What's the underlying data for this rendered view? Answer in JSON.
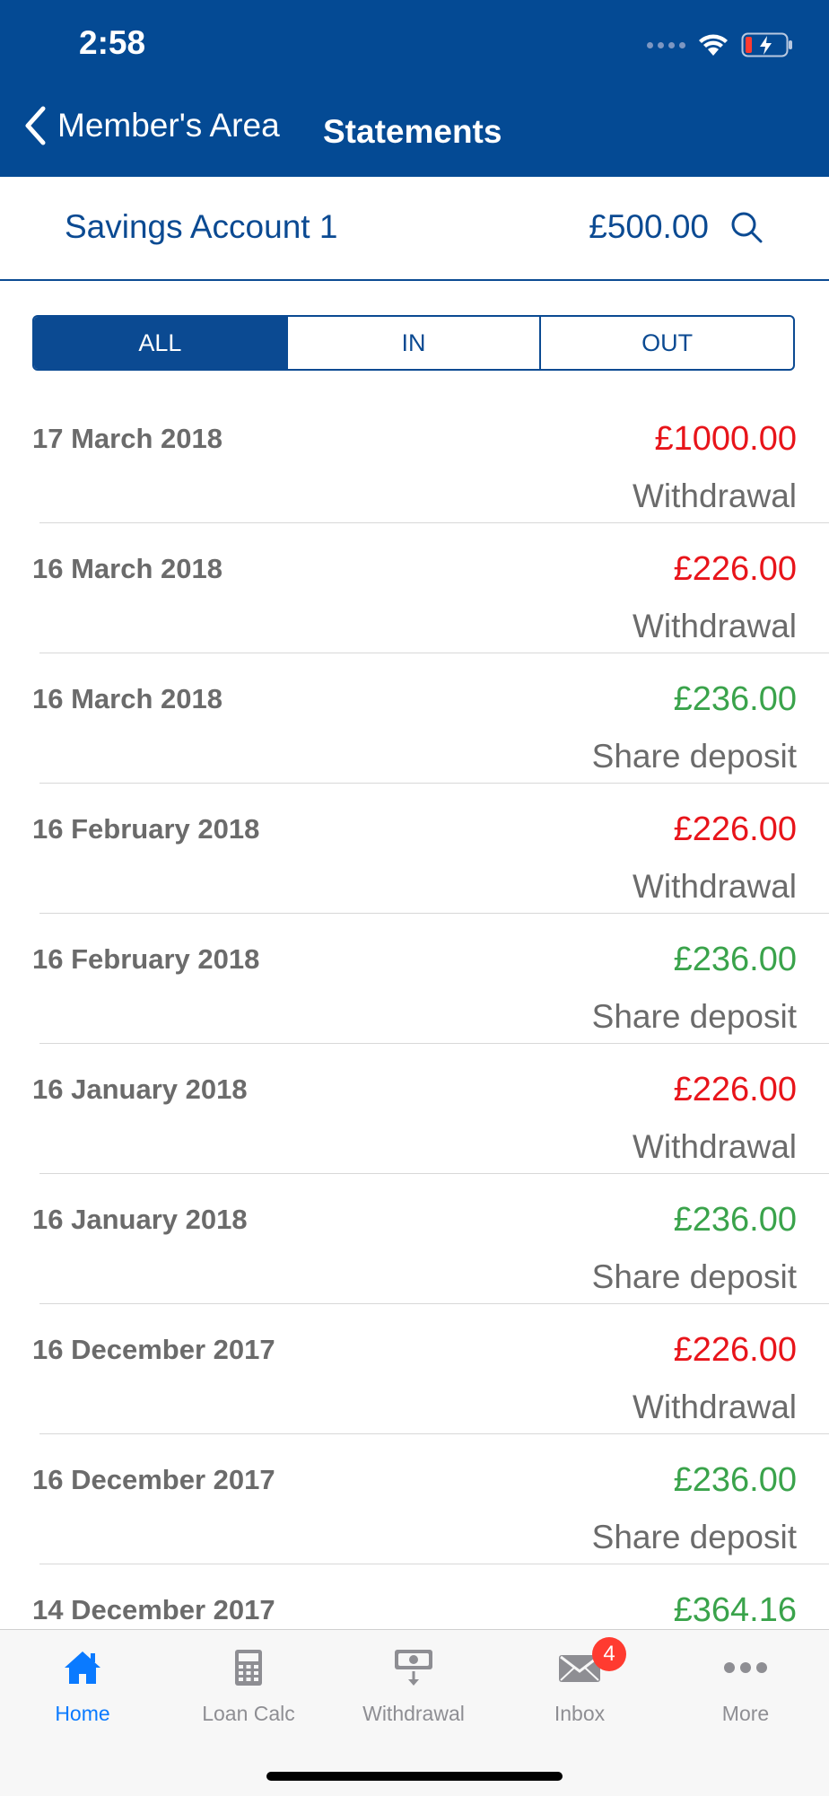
{
  "status": {
    "time": "2:58"
  },
  "nav": {
    "back_label": "Member's Area",
    "title": "Statements"
  },
  "account": {
    "name": "Savings Account 1",
    "balance": "£500.00"
  },
  "filters": [
    {
      "label": "ALL",
      "active": true
    },
    {
      "label": "IN",
      "active": false
    },
    {
      "label": "OUT",
      "active": false
    }
  ],
  "colors": {
    "brand": "#044a94",
    "withdrawal": "#e8141a",
    "deposit": "#3aa34b",
    "tab_active": "#0a7aff",
    "badge": "#ff3b30"
  },
  "transactions": [
    {
      "date": "17 March 2018",
      "amount": "£1000.00",
      "type": "Withdrawal",
      "direction": "out"
    },
    {
      "date": "16 March 2018",
      "amount": "£226.00",
      "type": "Withdrawal",
      "direction": "out"
    },
    {
      "date": "16 March 2018",
      "amount": "£236.00",
      "type": "Share deposit",
      "direction": "in"
    },
    {
      "date": "16 February 2018",
      "amount": "£226.00",
      "type": "Withdrawal",
      "direction": "out"
    },
    {
      "date": "16 February 2018",
      "amount": "£236.00",
      "type": "Share deposit",
      "direction": "in"
    },
    {
      "date": "16 January 2018",
      "amount": "£226.00",
      "type": "Withdrawal",
      "direction": "out"
    },
    {
      "date": "16 January 2018",
      "amount": "£236.00",
      "type": "Share deposit",
      "direction": "in"
    },
    {
      "date": "16 December 2017",
      "amount": "£226.00",
      "type": "Withdrawal",
      "direction": "out"
    },
    {
      "date": "16 December 2017",
      "amount": "£236.00",
      "type": "Share deposit",
      "direction": "in"
    },
    {
      "date": "14 December 2017",
      "amount": "£364.16",
      "type": "",
      "direction": "in"
    }
  ],
  "tabbar": {
    "tabs": [
      {
        "label": "Home",
        "icon": "home-icon",
        "active": true
      },
      {
        "label": "Loan Calc",
        "icon": "calculator-icon",
        "active": false
      },
      {
        "label": "Withdrawal",
        "icon": "cash-withdrawal-icon",
        "active": false
      },
      {
        "label": "Inbox",
        "icon": "mail-icon",
        "active": false,
        "badge": "4"
      },
      {
        "label": "More",
        "icon": "more-icon",
        "active": false
      }
    ]
  }
}
